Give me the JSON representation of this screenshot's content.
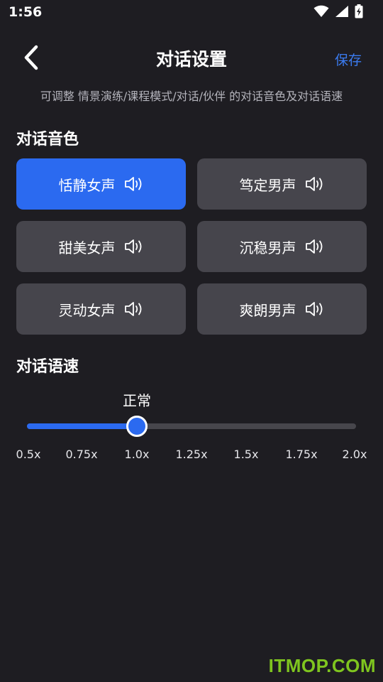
{
  "status_bar": {
    "time": "1:56",
    "icons": [
      "wifi-icon",
      "signal-icon",
      "battery-charging-icon"
    ]
  },
  "header": {
    "title": "对话设置",
    "save_label": "保存",
    "back_icon": "chevron-left-icon"
  },
  "subtitle": "可调整 情景演练/课程模式/对话/伙伴 的对话音色及对话语速",
  "voice_section": {
    "title": "对话音色",
    "options": [
      {
        "label": "恬静女声",
        "selected": true
      },
      {
        "label": "笃定男声",
        "selected": false
      },
      {
        "label": "甜美女声",
        "selected": false
      },
      {
        "label": "沉稳男声",
        "selected": false
      },
      {
        "label": "灵动女声",
        "selected": false
      },
      {
        "label": "爽朗男声",
        "selected": false
      }
    ],
    "icon": "speaker-icon"
  },
  "speed_section": {
    "title": "对话语速",
    "current_label": "正常",
    "current_value": "1.0x",
    "ticks": [
      "0.5x",
      "0.75x",
      "1.0x",
      "1.25x",
      "1.5x",
      "1.75x",
      "2.0x"
    ]
  },
  "colors": {
    "background": "#1e1d22",
    "accent": "#2b6af0",
    "button": "#46454c"
  },
  "watermark": "ITMOP.COM"
}
